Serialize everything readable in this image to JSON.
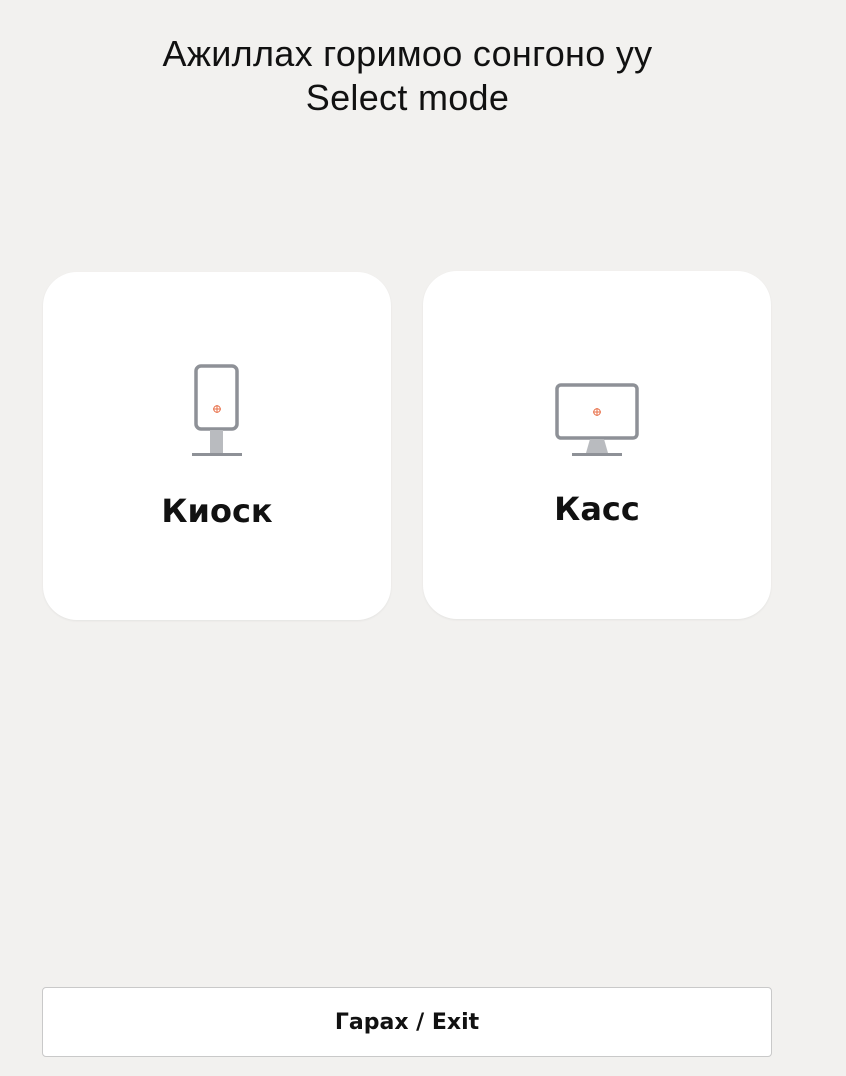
{
  "header": {
    "title_mn": "Ажиллах горимоо сонгоно уу",
    "title_en": "Select mode"
  },
  "modes": [
    {
      "label": "Киоск",
      "icon": "kiosk-icon"
    },
    {
      "label": "Касс",
      "icon": "monitor-icon"
    }
  ],
  "exit_button": {
    "label": "Гарах / Exit"
  },
  "colors": {
    "background": "#f2f1ef",
    "card": "#ffffff",
    "icon_stroke": "#8e9197",
    "icon_stand": "#b9bbbf",
    "icon_accent": "#e8704a"
  }
}
